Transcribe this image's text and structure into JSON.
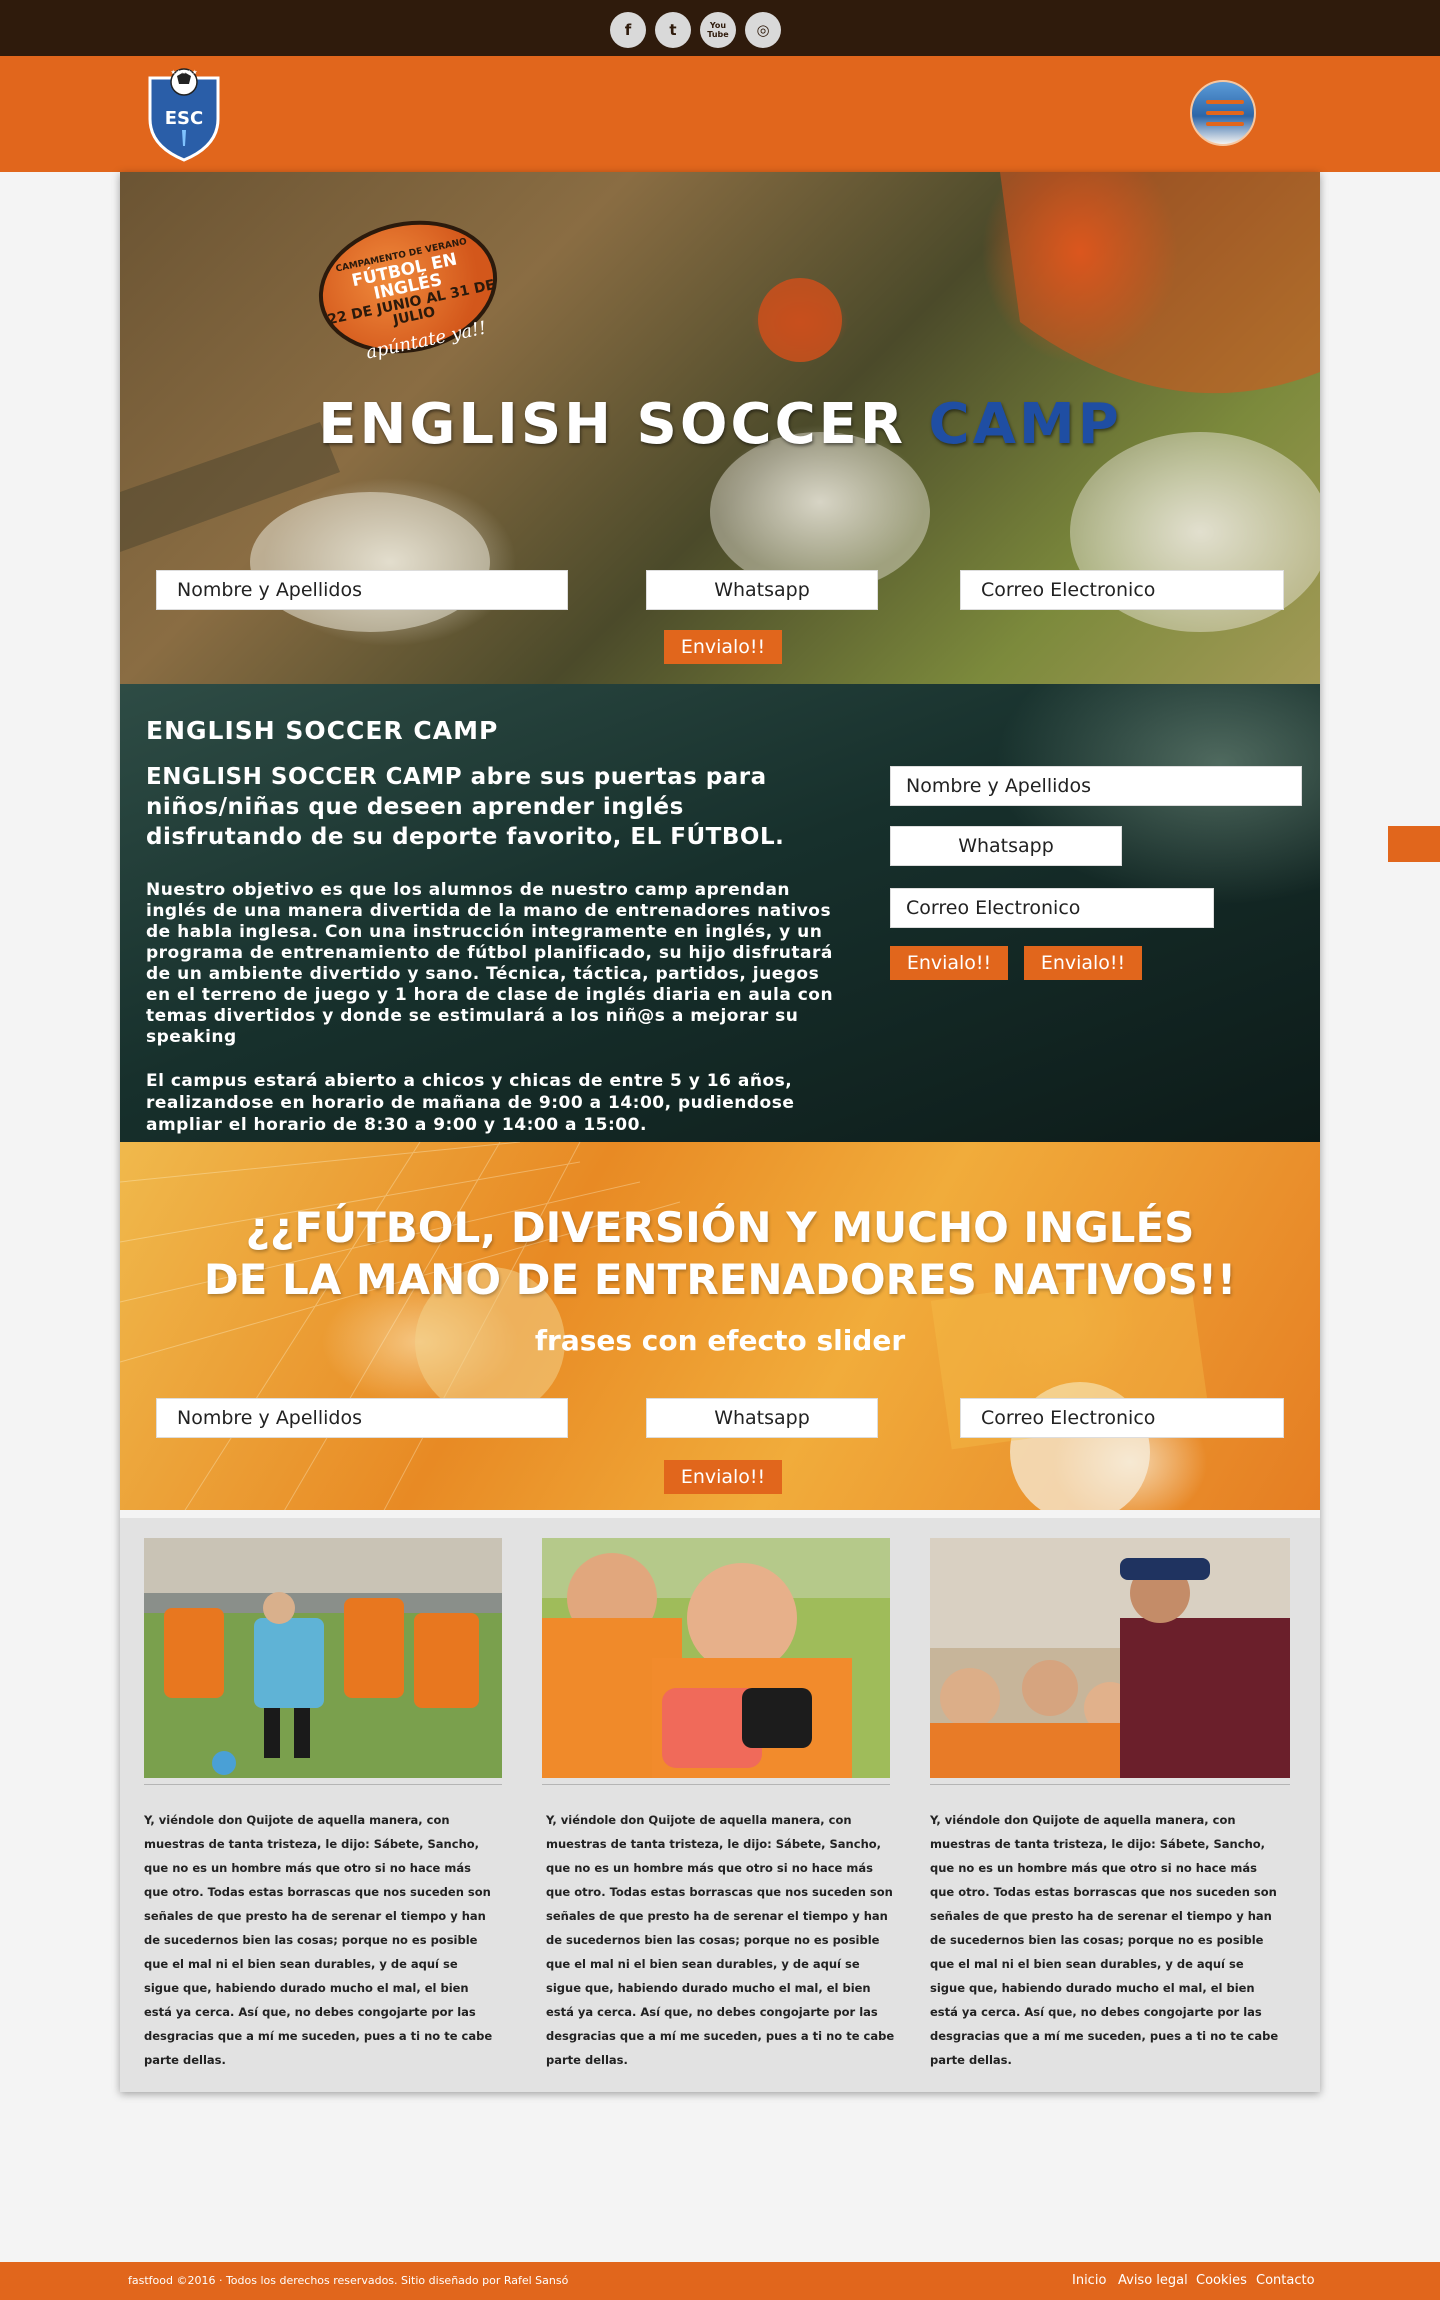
{
  "social": [
    {
      "icon": "facebook-icon",
      "glyph": "f"
    },
    {
      "icon": "twitter-icon",
      "glyph": "t"
    },
    {
      "icon": "youtube-icon",
      "glyph": "You Tube"
    },
    {
      "icon": "instagram-icon",
      "glyph": "◎"
    }
  ],
  "header": {
    "logo_text": "ESC",
    "menu_icon": "hamburger-menu-icon"
  },
  "hero": {
    "badge_line1": "CAMPAMENTO DE VERANO",
    "badge_line2": "FÚTBOL EN INGLÉS",
    "badge_line3": "22 DE JUNIO AL 31 DE JULIO",
    "badge_sub": "apúntate ya!!",
    "title_main": "ENGLISH SOCCER ",
    "title_accent": "CAMP",
    "form": {
      "name_placeholder": "Nombre y Apellidos",
      "whatsapp_placeholder": "Whatsapp",
      "email_placeholder": "Correo Electronico",
      "submit": "Envialo!!"
    }
  },
  "about": {
    "heading": "ENGLISH SOCCER CAMP",
    "lead": "ENGLISH SOCCER CAMP abre sus puertas para niños/niñas que deseen aprender inglés disfrutando de su deporte favorito, EL FÚTBOL.",
    "paragraph1": "Nuestro objetivo es que los alumnos de nuestro camp aprendan inglés de una manera divertida de la mano de entrenadores nativos de habla inglesa. Con una instrucción integramente en inglés, y un programa de entrenamiento de fútbol planificado, su hijo disfrutará de un ambiente divertido y sano. Técnica, táctica, partidos, juegos en el terreno de juego y 1 hora de clase de inglés diaria en aula con temas divertidos y donde se estimulará a los niñ@s a mejorar su speaking",
    "paragraph2": "El campus estará abierto a chicos y chicas de entre 5 y 16 años, realizandose en horario de mañana de 9:00 a 14:00, pudiendose ampliar el horario de 8:30 a 9:00 y 14:00 a 15:00.",
    "form": {
      "name_placeholder": "Nombre y Apellidos",
      "whatsapp_placeholder": "Whatsapp",
      "email_placeholder": "Correo Electronico",
      "submit1": "Envialo!!",
      "submit2": "Envialo!!"
    }
  },
  "slider": {
    "line1": "¿¿FÚTBOL, DIVERSIÓN Y MUCHO INGLÉS",
    "line2": "DE LA MANO DE ENTRENADORES NATIVOS!!",
    "subtitle": "frases con efecto slider",
    "form": {
      "name_placeholder": "Nombre y Apellidos",
      "whatsapp_placeholder": "Whatsapp",
      "email_placeholder": "Correo Electronico",
      "submit": "Envialo!!"
    }
  },
  "cards": [
    {
      "text": "Y, viéndole don Quijote de aquella manera, con muestras de tanta tristeza, le dijo: Sábete, Sancho, que no es un hombre más que otro si no hace más que otro. Todas estas borrascas que nos suceden son señales de que presto ha de serenar el tiempo y han de sucedernos bien las cosas; porque no es posible que el mal ni el bien sean durables, y de aquí se sigue que, habiendo durado mucho el mal, el bien está ya cerca. Así que, no debes congojarte por las desgracias que a mí me suceden, pues a ti no te cabe parte dellas."
    },
    {
      "text": "Y, viéndole don Quijote de aquella manera, con muestras de tanta tristeza, le dijo: Sábete, Sancho, que no es un hombre más que otro si no hace más que otro. Todas estas borrascas que nos suceden son señales de que presto ha de serenar el tiempo y han de sucedernos bien las cosas; porque no es posible que el mal ni el bien sean durables, y de aquí se sigue que, habiendo durado mucho el mal, el bien está ya cerca. Así que, no debes congojarte por las desgracias que a mí me suceden, pues a ti no te cabe parte dellas."
    },
    {
      "text": "Y, viéndole don Quijote de aquella manera, con muestras de tanta tristeza, le dijo: Sábete, Sancho, que no es un hombre más que otro si no hace más que otro. Todas estas borrascas que nos suceden son señales de que presto ha de serenar el tiempo y han de sucedernos bien las cosas; porque no es posible que el mal ni el bien sean durables, y de aquí se sigue que, habiendo durado mucho el mal, el bien está ya cerca. Así que, no debes congojarte por las desgracias que a mí me suceden, pues a ti no te cabe parte dellas."
    }
  ],
  "footer": {
    "copyright": "fastfood ©2016 · Todos los derechos reservados. Sitio diseñado por Rafel Sansó",
    "links": [
      "Inicio",
      "Aviso legal",
      "Cookies",
      "Contacto"
    ]
  },
  "colors": {
    "accent": "#e1661c",
    "top_bar": "#2f1b0c",
    "title_accent": "#1f4ea3"
  }
}
